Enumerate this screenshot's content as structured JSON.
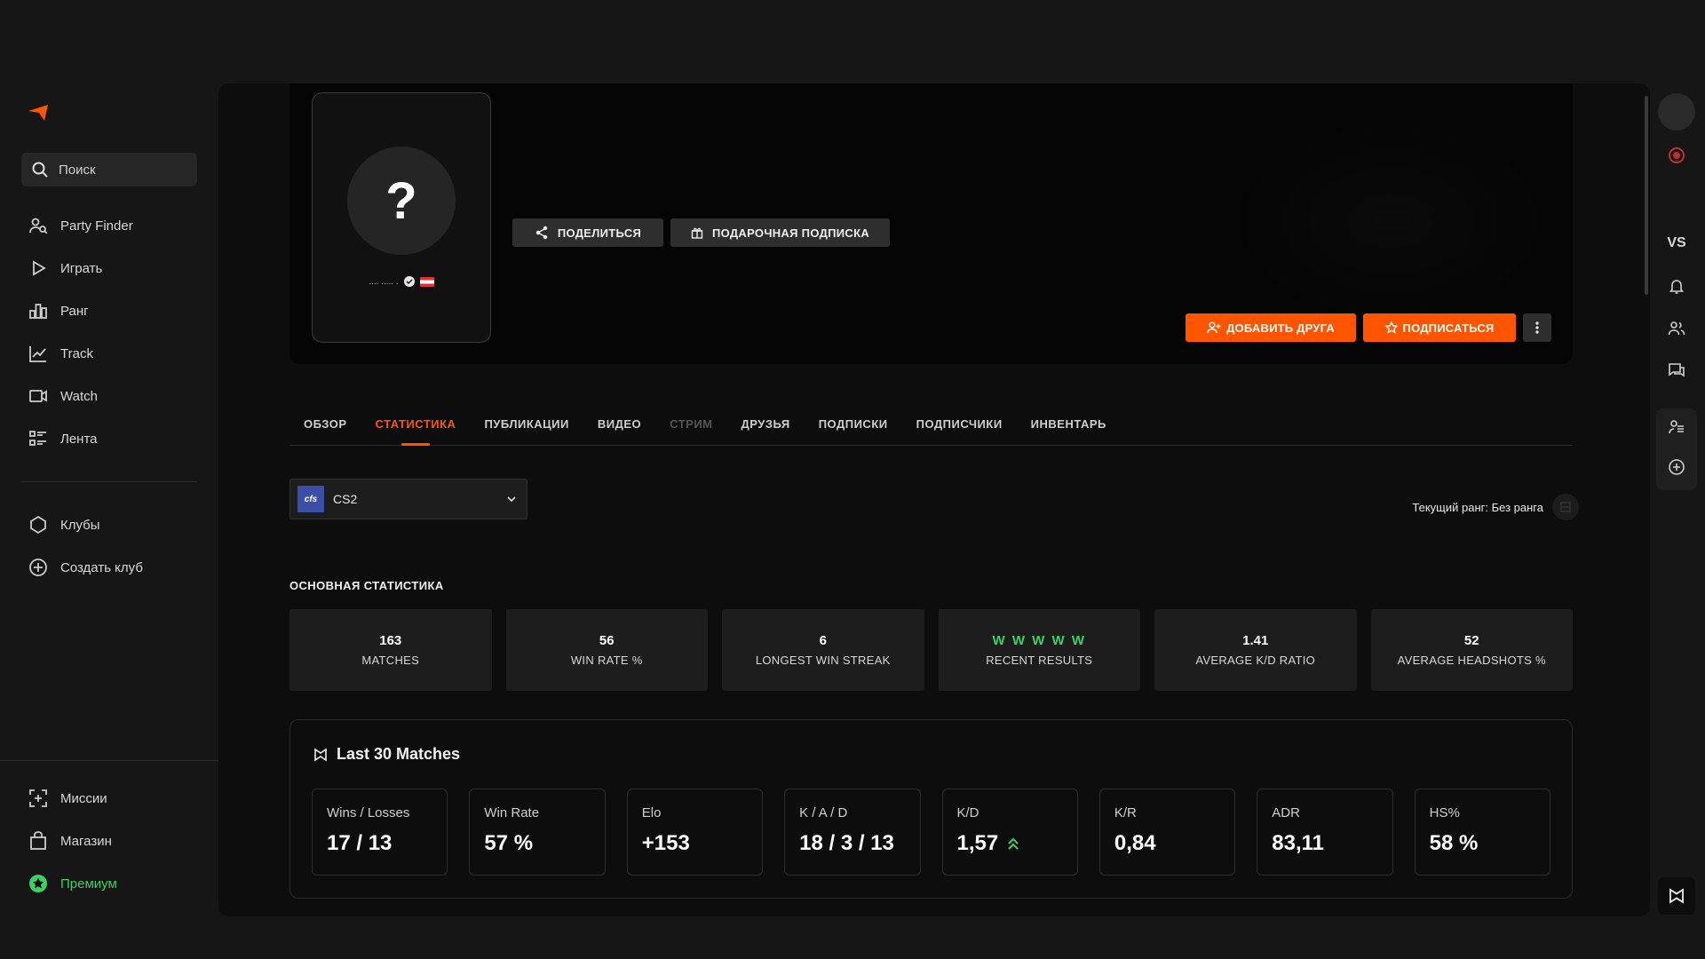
{
  "sidebar": {
    "search_label": "Поиск",
    "nav": [
      {
        "label": "Party Finder",
        "icon": "party-finder-icon"
      },
      {
        "label": "Играть",
        "icon": "play-icon"
      },
      {
        "label": "Ранг",
        "icon": "rank-icon"
      },
      {
        "label": "Track",
        "icon": "track-icon"
      },
      {
        "label": "Watch",
        "icon": "watch-icon"
      },
      {
        "label": "Лента",
        "icon": "feed-icon"
      }
    ],
    "clubs": [
      {
        "label": "Клубы",
        "icon": "clubs-icon"
      },
      {
        "label": "Создать клуб",
        "icon": "create-club-icon"
      }
    ],
    "bottom": [
      {
        "label": "Миссии",
        "icon": "missions-icon"
      },
      {
        "label": "Магазин",
        "icon": "shop-icon"
      },
      {
        "label": "Премиум",
        "icon": "premium-icon"
      }
    ]
  },
  "profile": {
    "avatar_placeholder": "?",
    "name_masked": ".... ..... .",
    "share_label": "ПОДЕЛИТЬСЯ",
    "gift_label": "ПОДАРОЧНАЯ ПОДПИСКА",
    "add_friend_label": "ДОБАВИТЬ ДРУГА",
    "subscribe_label": "ПОДПИСАТЬСЯ"
  },
  "tabs": [
    {
      "label": "ОБЗОР",
      "state": "normal"
    },
    {
      "label": "СТАТИСТИКА",
      "state": "active"
    },
    {
      "label": "ПУБЛИКАЦИИ",
      "state": "normal"
    },
    {
      "label": "ВИДЕО",
      "state": "normal"
    },
    {
      "label": "СТРИМ",
      "state": "disabled"
    },
    {
      "label": "ДРУЗЬЯ",
      "state": "normal"
    },
    {
      "label": "ПОДПИСКИ",
      "state": "normal"
    },
    {
      "label": "ПОДПИСЧИКИ",
      "state": "normal"
    },
    {
      "label": "ИНВЕНТАРЬ",
      "state": "normal"
    }
  ],
  "game": {
    "logo_text": "cfs",
    "selected": "CS2"
  },
  "rank": {
    "text": "Текущий ранг: Без ранга"
  },
  "main_stats": {
    "title": "ОСНОВНАЯ СТАТИСТИКА",
    "items": [
      {
        "value": "163",
        "label": "MATCHES"
      },
      {
        "value": "56",
        "label": "WIN RATE %"
      },
      {
        "value": "6",
        "label": "LONGEST WIN STREAK"
      },
      {
        "value": "W W W W W",
        "label": "RECENT RESULTS"
      },
      {
        "value": "1.41",
        "label": "AVERAGE K/D RATIO"
      },
      {
        "value": "52",
        "label": "AVERAGE HEADSHOTS %"
      }
    ]
  },
  "last30": {
    "title": "Last 30 Matches",
    "cards": [
      {
        "label": "Wins / Losses",
        "value": "17 / 13"
      },
      {
        "label": "Win Rate",
        "value": "57 %"
      },
      {
        "label": "Elo",
        "value": "+153"
      },
      {
        "label": "K / A / D",
        "value": "18 / 3 / 13"
      },
      {
        "label": "K/D",
        "value": "1,57"
      },
      {
        "label": "K/R",
        "value": "0,84"
      },
      {
        "label": "ADR",
        "value": "83,11"
      },
      {
        "label": "HS%",
        "value": "58 %"
      }
    ]
  },
  "right_rail": {
    "vs_label": "VS"
  },
  "colors": {
    "accent": "#ff5500",
    "success": "#3dd068",
    "background": "#161616",
    "panel": "#0d0d0d"
  }
}
